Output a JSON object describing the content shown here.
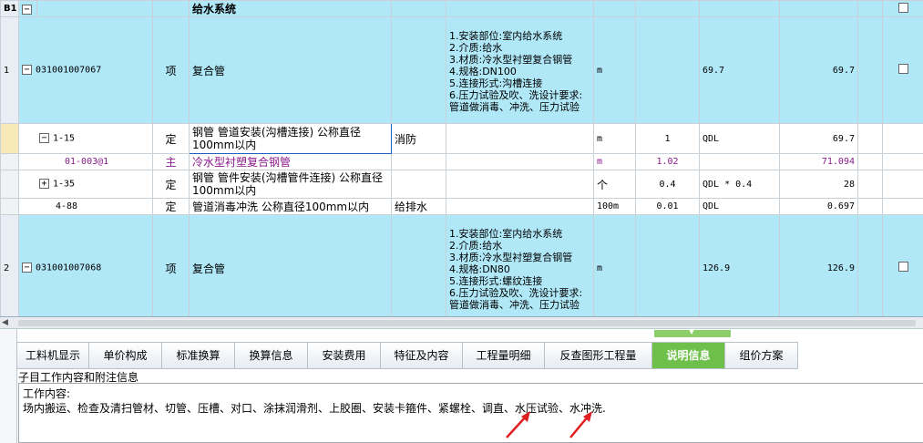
{
  "grid": {
    "header_row": {
      "id": "B1",
      "toggle": "−",
      "name": "给水系统"
    },
    "rows": [
      {
        "kind": "item",
        "index": "1",
        "toggle": "−",
        "code": "031001007067",
        "type": "项",
        "name": "复合管",
        "features": "1.安装部位:室内给水系统\n2.介质:给水\n3.材质:冷水型衬塑复合钢管\n4.规格:DN100\n5.连接形式:沟槽连接\n6.压力试验及吹、洗设计要求:管道做消毒、冲洗、压力试验",
        "unit": "m",
        "quantity": "",
        "expr": "69.7",
        "total": "69.7"
      },
      {
        "kind": "sub",
        "toggle": "−",
        "code": "1-15",
        "type": "定",
        "name": "钢管 管道安装(沟槽连接) 公称直径100mm以内",
        "spec": "消防",
        "unit": "m",
        "quantity": "1",
        "expr": "QDL",
        "total": "69.7"
      },
      {
        "kind": "material",
        "code": "01-003@1",
        "type": "主",
        "name": "冷水型衬塑复合钢管",
        "unit": "m",
        "quantity": "1.02",
        "total": "71.094"
      },
      {
        "kind": "sub",
        "toggle": "+",
        "code": "1-35",
        "type": "定",
        "name": "钢管 管件安装(沟槽管件连接) 公称直径100mm以内",
        "spec": "",
        "unit": "个",
        "quantity": "0.4",
        "expr": "QDL * 0.4",
        "total": "28"
      },
      {
        "kind": "sub",
        "code": "4-88",
        "type": "定",
        "name": "管道消毒冲洗 公称直径100mm以内",
        "spec": "给排水",
        "unit": "100m",
        "quantity": "0.01",
        "expr": "QDL",
        "total": "0.697"
      },
      {
        "kind": "item",
        "index": "2",
        "toggle": "−",
        "code": "031001007068",
        "type": "项",
        "name": "复合管",
        "features": "1.安装部位:室内给水系统\n2.介质:给水\n3.材质:冷水型衬塑复合钢管\n4.规格:DN80\n5.连接形式:螺纹连接\n6.压力试验及吹、洗设计要求:管道做消毒、冲洗、压力试验",
        "unit": "m",
        "quantity": "",
        "expr": "126.9",
        "total": "126.9"
      }
    ]
  },
  "tabs": [
    "工料机显示",
    "单价构成",
    "标准换算",
    "换算信息",
    "安装费用",
    "特征及内容",
    "工程量明细",
    "反查图形工程量",
    "说明信息",
    "组价方案"
  ],
  "active_tab": "说明信息",
  "notes": {
    "title": "子目工作内容和附注信息",
    "label": "工作内容:",
    "content": "场内搬运、检查及清扫管材、切管、压槽、对口、涂抹润滑剂、上胶圈、安装卡箍件、紧螺栓、调直、水压试验、水冲洗."
  },
  "colors": {
    "item_row": "#b0e8f8",
    "material_text": "#8b1a8b",
    "active_tab": "#6ec04a",
    "annotation_arrow": "#e02020"
  },
  "icons": {
    "expanded": "minus-box-icon",
    "collapsed": "plus-box-icon",
    "handle": "chevron-down-icon",
    "scroll_left": "scroll-left-arrow-icon"
  }
}
